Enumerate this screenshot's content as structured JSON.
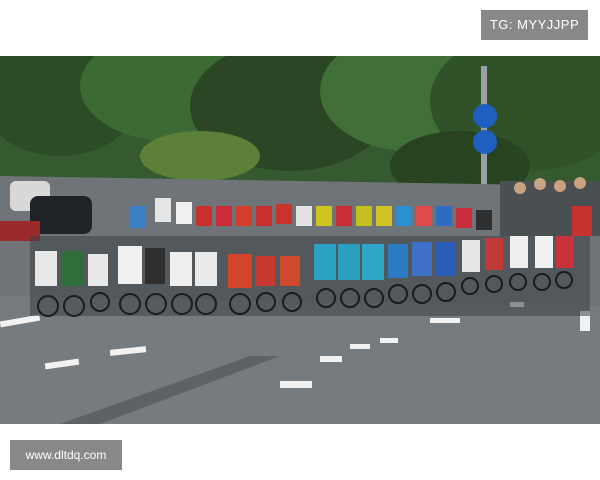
{
  "watermark_top": "TG: MYYJJPP",
  "watermark_bottom": "www.dltdq.com",
  "photo": {
    "subject": "peloton-road-race",
    "colors": {
      "road": "#6f7478",
      "trees": "#2f4a2a",
      "sky": "#dfe6dd",
      "sign_blue": "#1f5fbf",
      "marking": "#f2f2f2"
    }
  }
}
